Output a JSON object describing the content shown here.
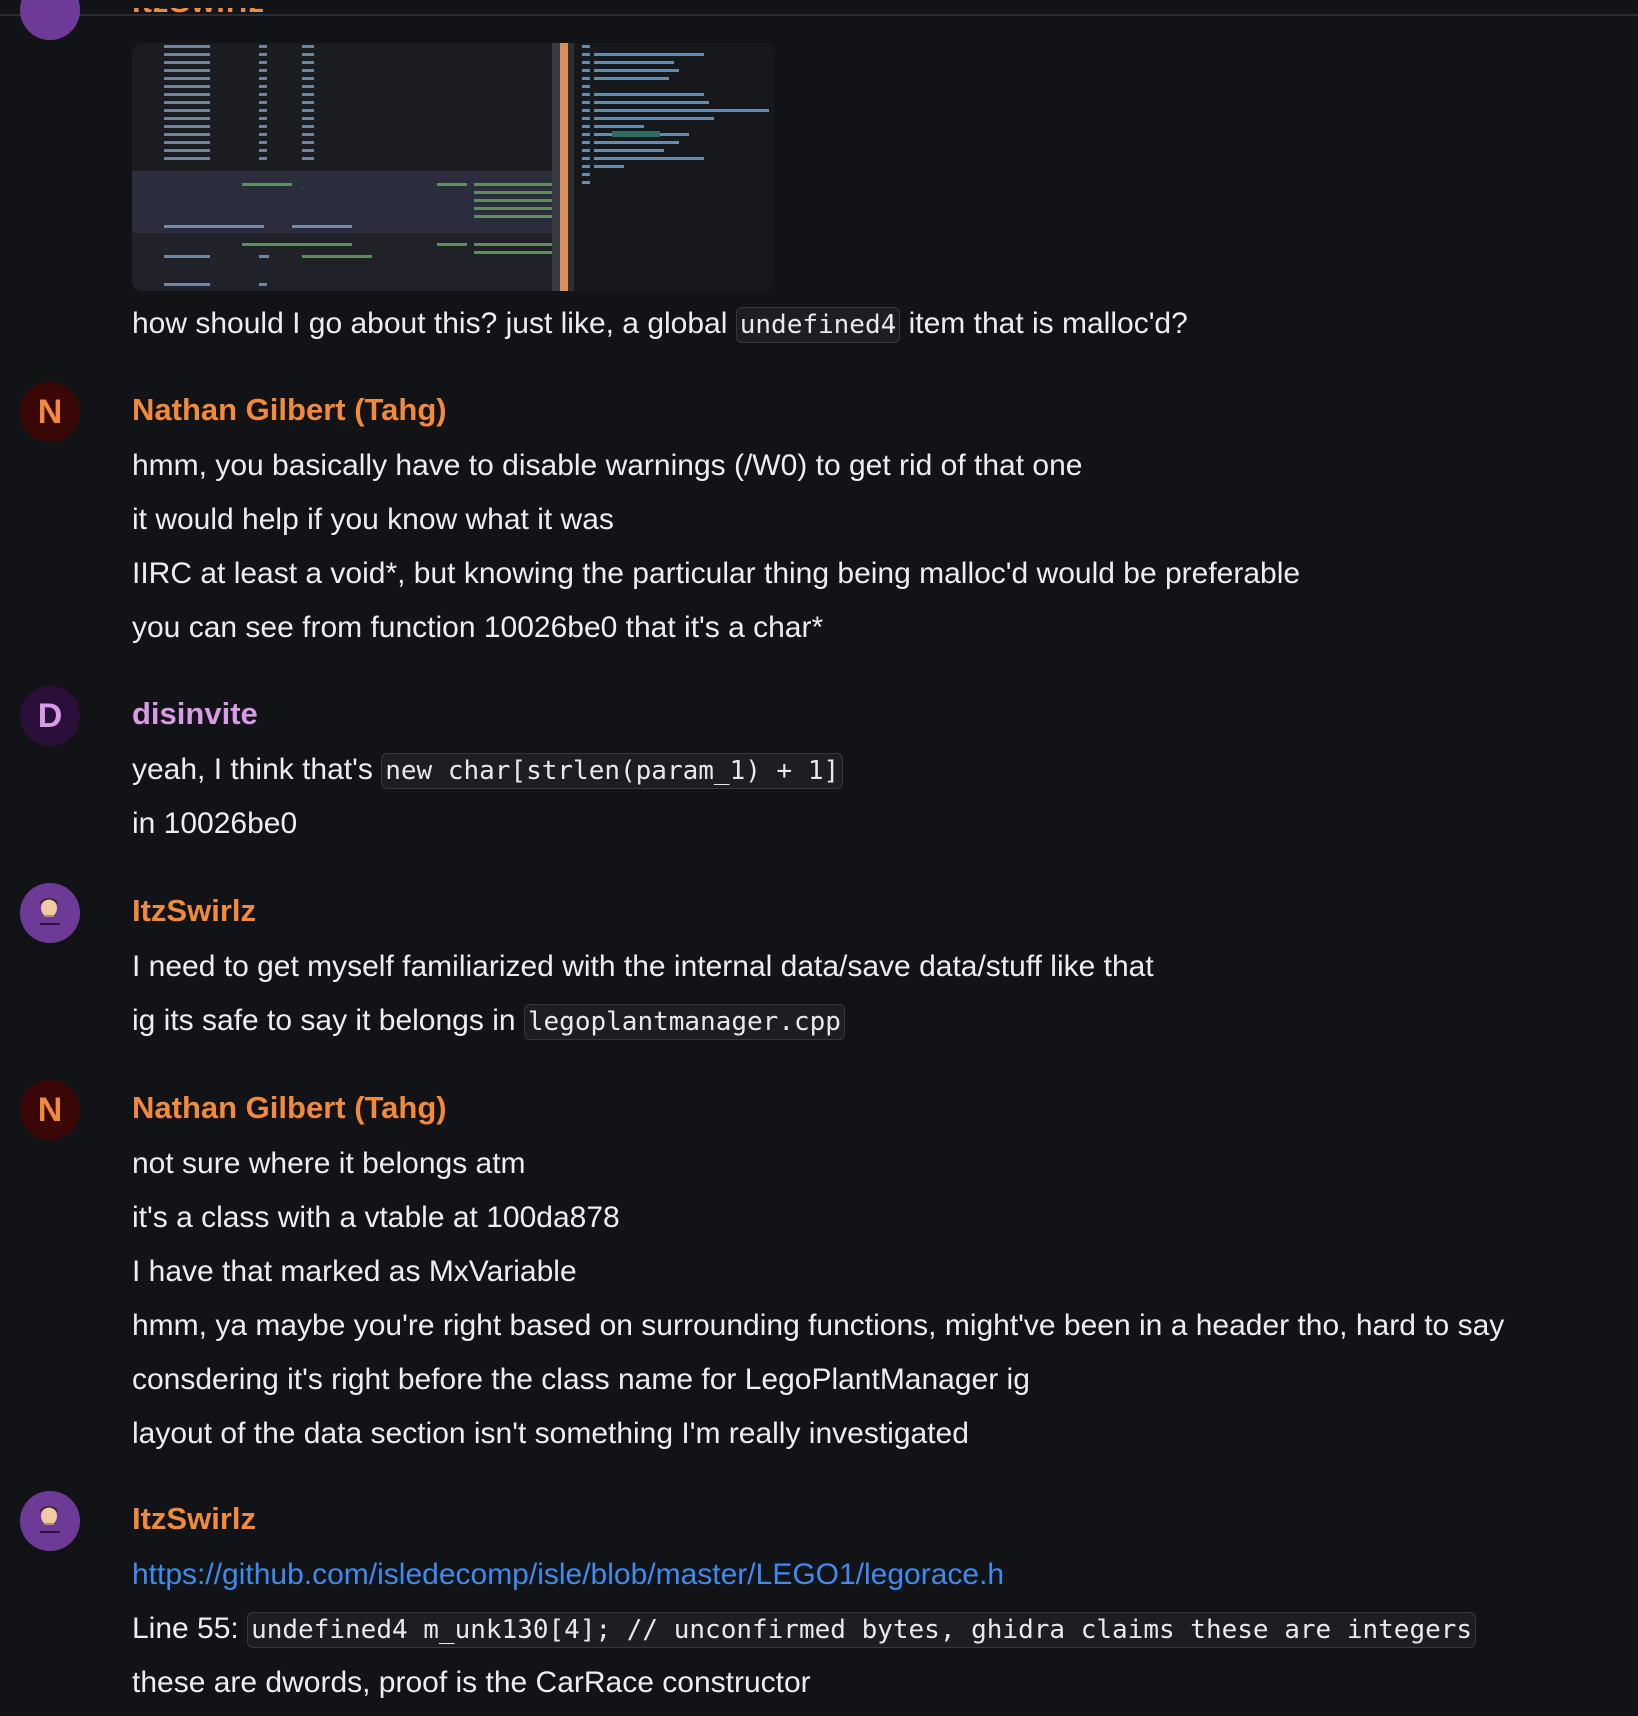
{
  "colors": {
    "background": "#121316",
    "text": "#eceef1",
    "nathan": "#f28a3c",
    "disinvite": "#d99ae6",
    "itzswirlz": "#f28a3c",
    "link": "#3d8bf0",
    "code_bg": "#1c1e22"
  },
  "top": {
    "partial_author": "ItzSwirlz",
    "message": {
      "before": "how should I go about this? just like, a global ",
      "code": "undefined4",
      "after": " item that is malloc'd?"
    }
  },
  "messages": [
    {
      "author": "Nathan Gilbert (Tahg)",
      "avatar_letter": "N",
      "lines": [
        "hmm, you basically have to disable warnings (/W0) to get rid of that one",
        "it would help if you know what it was",
        "IIRC at least a void*, but knowing the particular thing being malloc'd would be preferable",
        "you can see from function 10026be0 that it's a char*"
      ]
    },
    {
      "author": "disinvite",
      "avatar_letter": "D",
      "line1_before": "yeah, I think that's ",
      "line1_code": "new char[strlen(param_1) + 1]",
      "line2": "in 10026be0"
    },
    {
      "author": "ItzSwirlz",
      "line1": "I need to get myself familiarized with the internal data/save data/stuff like that",
      "line2_before": "ig its safe to say it belongs in ",
      "line2_code": "legoplantmanager.cpp"
    },
    {
      "author": "Nathan Gilbert (Tahg)",
      "avatar_letter": "N",
      "lines": [
        "not sure where it belongs atm",
        "it's a class with a vtable at 100da878",
        "I have that marked as MxVariable",
        "hmm, ya maybe you're right based on surrounding functions, might've been in a header tho, hard to say",
        "consdering it's right before the class name for LegoPlantManager ig",
        "layout of the data section isn't something I'm really investigated"
      ]
    },
    {
      "author": "ItzSwirlz",
      "link": "https://github.com/isledecomp/isle/blob/master/LEGO1/legorace.h",
      "line2_before": "Line 55: ",
      "line2_code": "undefined4 m_unk130[4]; // unconfirmed bytes, ghidra claims these are integers",
      "line3": "these are dwords, proof is the CarRace constructor"
    }
  ]
}
